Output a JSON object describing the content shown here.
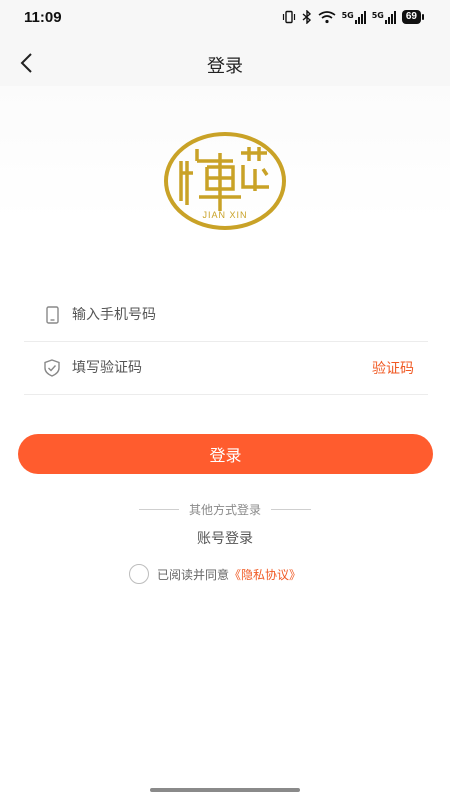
{
  "status_bar": {
    "time": "11:09",
    "network_1": "5G",
    "network_2": "5G",
    "battery": "69"
  },
  "header": {
    "title": "登录"
  },
  "logo": {
    "text": "JIAN XIN",
    "color": "#c9a227"
  },
  "form": {
    "phone_placeholder": "输入手机号码",
    "code_placeholder": "填写验证码",
    "code_button": "验证码"
  },
  "login_button": "登录",
  "other_methods": {
    "label": "其他方式登录",
    "account_login": "账号登录"
  },
  "agreement": {
    "text": "已阅读并同意",
    "link": "《隐私协议》"
  },
  "colors": {
    "accent": "#ff5c2e",
    "link": "#f05a24",
    "gold": "#c9a227"
  }
}
